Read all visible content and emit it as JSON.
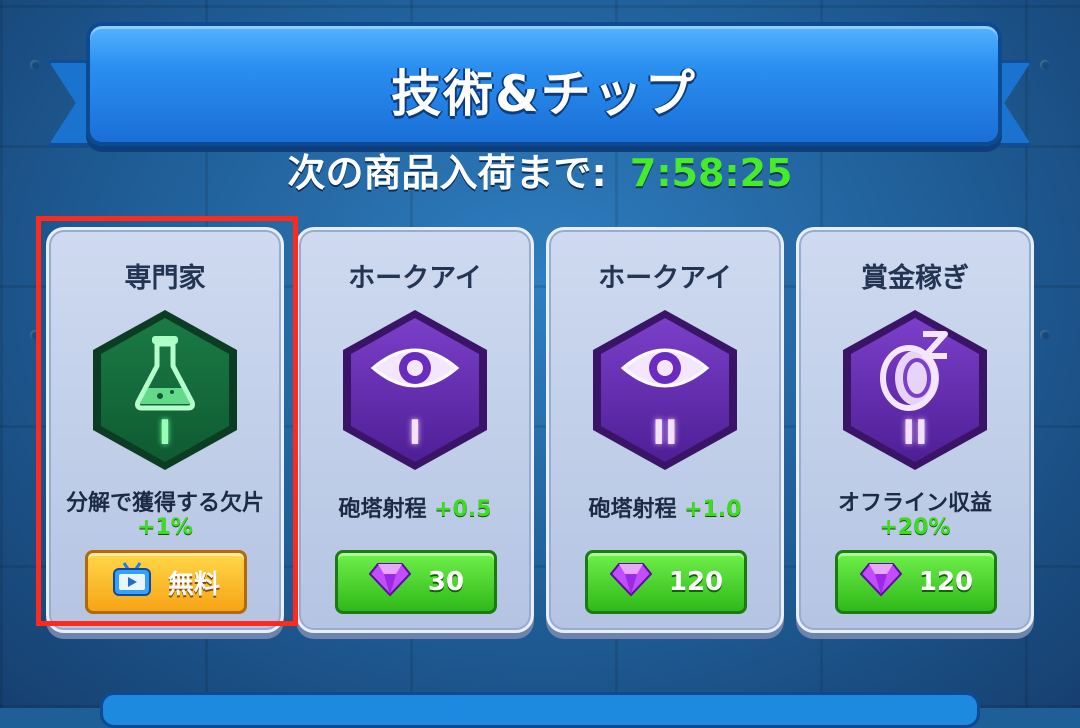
{
  "header": {
    "title": "技術&チップ",
    "restock_label": "次の商品入荷まで:",
    "restock_timer": "7:58:25"
  },
  "cards": [
    {
      "name": "専門家",
      "icon": "flask-icon",
      "tier": "I",
      "tier_color": "green",
      "effect_label": "分解で獲得する欠片",
      "effect_bonus": "+1%",
      "price_label": "無料",
      "price_type": "free-video",
      "selected": true
    },
    {
      "name": "ホークアイ",
      "icon": "eye-icon",
      "tier": "I",
      "tier_color": "purple",
      "effect_label": "砲塔射程",
      "effect_bonus": "+0.5",
      "price_value": "30",
      "price_type": "gem"
    },
    {
      "name": "ホークアイ",
      "icon": "eye-icon",
      "tier": "II",
      "tier_color": "purple",
      "effect_label": "砲塔射程",
      "effect_bonus": "+1.0",
      "price_value": "120",
      "price_type": "gem"
    },
    {
      "name": "賞金稼ぎ",
      "icon": "sleeping-coin-icon",
      "tier": "II",
      "tier_color": "purple",
      "effect_label": "オフライン収益",
      "effect_bonus": "+20%",
      "price_value": "120",
      "price_type": "gem"
    }
  ],
  "colors": {
    "timer": "#46ec2a",
    "bonus": "#3ddb21",
    "selection": "#ff2a1e",
    "gem_button": "#2fb91a",
    "free_button": "#f7a415"
  }
}
